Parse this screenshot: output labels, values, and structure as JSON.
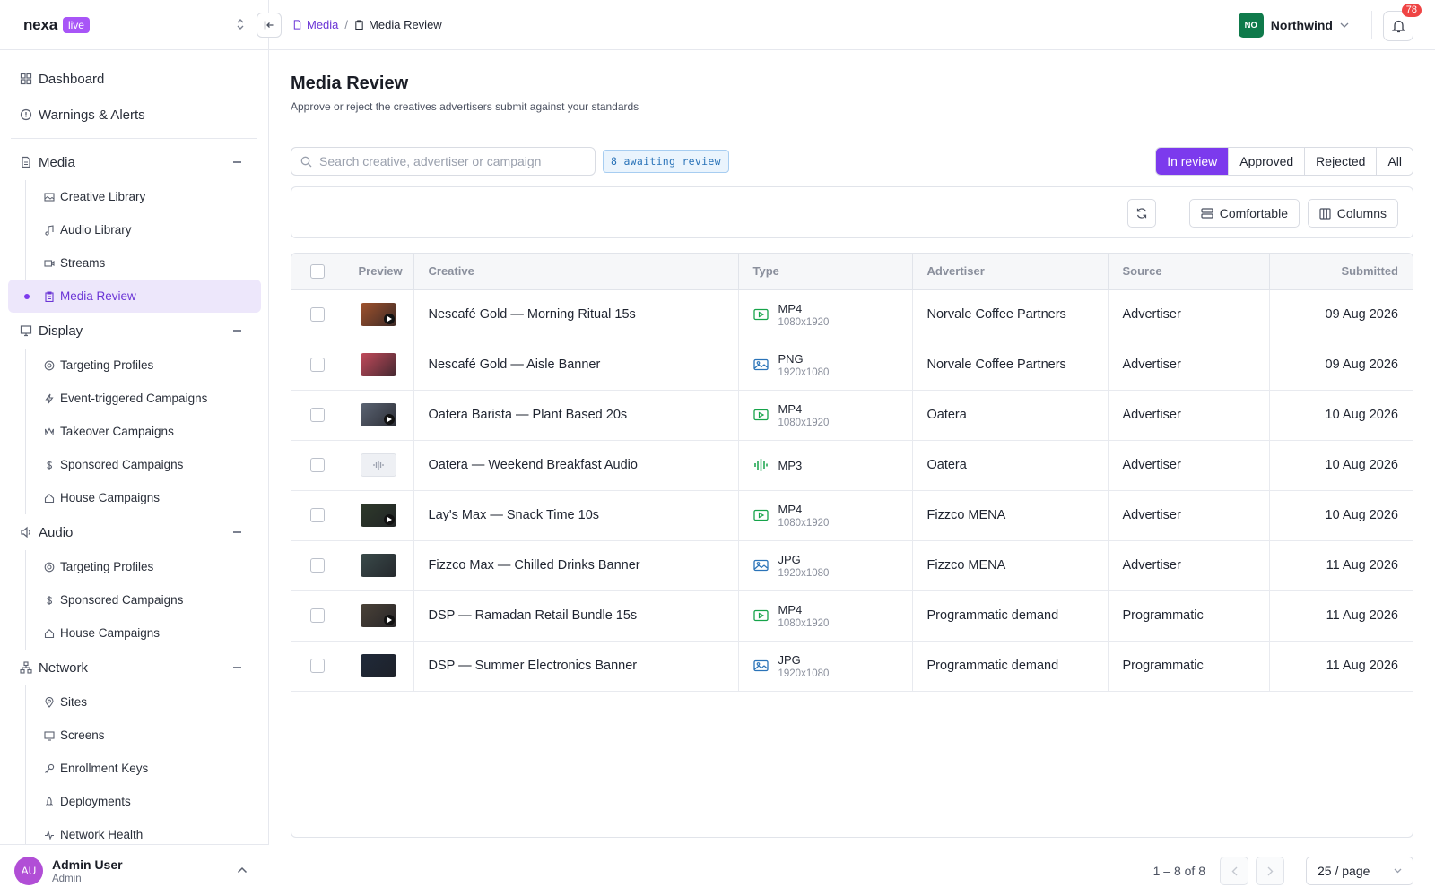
{
  "brand": {
    "name": "nexa",
    "badge": "live"
  },
  "sidebar": {
    "top": [
      {
        "label": "Dashboard",
        "icon": "grid-icon"
      },
      {
        "label": "Warnings & Alerts",
        "icon": "alert-circle-icon"
      }
    ],
    "groups": [
      {
        "label": "Media",
        "icon": "file-icon",
        "items": [
          {
            "label": "Creative Library",
            "icon": "images-icon"
          },
          {
            "label": "Audio Library",
            "icon": "music-note-icon"
          },
          {
            "label": "Streams",
            "icon": "video-icon"
          },
          {
            "label": "Media Review",
            "icon": "clipboard-icon",
            "active": true
          }
        ]
      },
      {
        "label": "Display",
        "icon": "monitor-icon",
        "items": [
          {
            "label": "Targeting Profiles",
            "icon": "target-icon"
          },
          {
            "label": "Event-triggered Campaigns",
            "icon": "bolt-icon"
          },
          {
            "label": "Takeover Campaigns",
            "icon": "crown-icon"
          },
          {
            "label": "Sponsored Campaigns",
            "icon": "dollar-icon"
          },
          {
            "label": "House Campaigns",
            "icon": "home-icon"
          }
        ]
      },
      {
        "label": "Audio",
        "icon": "speaker-icon",
        "items": [
          {
            "label": "Targeting Profiles",
            "icon": "target-icon"
          },
          {
            "label": "Sponsored Campaigns",
            "icon": "dollar-icon"
          },
          {
            "label": "House Campaigns",
            "icon": "home-icon"
          }
        ]
      },
      {
        "label": "Network",
        "icon": "network-icon",
        "items": [
          {
            "label": "Sites",
            "icon": "map-pin-icon"
          },
          {
            "label": "Screens",
            "icon": "screen-icon"
          },
          {
            "label": "Enrollment Keys",
            "icon": "key-icon"
          },
          {
            "label": "Deployments",
            "icon": "rocket-icon"
          },
          {
            "label": "Network Health",
            "icon": "activity-icon"
          }
        ]
      }
    ]
  },
  "user": {
    "initials": "AU",
    "name": "Admin User",
    "role": "Admin"
  },
  "header": {
    "breadcrumb": {
      "parent": "Media",
      "separator": "/",
      "current": "Media Review"
    },
    "org": {
      "initials": "NO",
      "name": "Northwind"
    },
    "notifications": "78"
  },
  "page": {
    "title": "Media Review",
    "subtitle": "Approve or reject the creatives advertisers submit against your standards"
  },
  "filters": {
    "search_placeholder": "Search creative, advertiser or campaign",
    "awaiting": "8 awaiting review",
    "tabs": [
      "In review",
      "Approved",
      "Rejected",
      "All"
    ],
    "active_tab": "In review"
  },
  "toolbar": {
    "density": "Comfortable",
    "columns": "Columns"
  },
  "table": {
    "headers": {
      "preview": "Preview",
      "creative": "Creative",
      "type": "Type",
      "advertiser": "Advertiser",
      "source": "Source",
      "submitted": "Submitted"
    },
    "rows": [
      {
        "creative": "Nescafé Gold — Morning Ritual 15s",
        "format": "MP4",
        "resolution": "1080x1920",
        "kind": "video",
        "thumb": "#a0522d",
        "advertiser": "Norvale Coffee Partners",
        "source": "Advertiser",
        "submitted": "09 Aug 2026"
      },
      {
        "creative": "Nescafé Gold — Aisle Banner",
        "format": "PNG",
        "resolution": "1920x1080",
        "kind": "image",
        "thumb": "#c24a5a",
        "advertiser": "Norvale Coffee Partners",
        "source": "Advertiser",
        "submitted": "09 Aug 2026"
      },
      {
        "creative": "Oatera Barista — Plant Based 20s",
        "format": "MP4",
        "resolution": "1080x1920",
        "kind": "video",
        "thumb": "#5b6473",
        "advertiser": "Oatera",
        "source": "Advertiser",
        "submitted": "10 Aug 2026"
      },
      {
        "creative": "Oatera — Weekend Breakfast Audio",
        "format": "MP3",
        "resolution": "",
        "kind": "audio",
        "thumb": "#eef0f4",
        "advertiser": "Oatera",
        "source": "Advertiser",
        "submitted": "10 Aug 2026"
      },
      {
        "creative": "Lay's Max — Snack Time 10s",
        "format": "MP4",
        "resolution": "1080x1920",
        "kind": "video",
        "thumb": "#2e3a2b",
        "advertiser": "Fizzco MENA",
        "source": "Advertiser",
        "submitted": "10 Aug 2026"
      },
      {
        "creative": "Fizzco Max — Chilled Drinks Banner",
        "format": "JPG",
        "resolution": "1920x1080",
        "kind": "image",
        "thumb": "#3a4a4a",
        "advertiser": "Fizzco MENA",
        "source": "Advertiser",
        "submitted": "11 Aug 2026"
      },
      {
        "creative": "DSP — Ramadan Retail Bundle 15s",
        "format": "MP4",
        "resolution": "1080x1920",
        "kind": "video",
        "thumb": "#4a4238",
        "advertiser": "Programmatic demand",
        "source": "Programmatic",
        "submitted": "11 Aug 2026"
      },
      {
        "creative": "DSP — Summer Electronics Banner",
        "format": "JPG",
        "resolution": "1920x1080",
        "kind": "image",
        "thumb": "#1f2a3a",
        "advertiser": "Programmatic demand",
        "source": "Programmatic",
        "submitted": "11 Aug 2026"
      }
    ]
  },
  "pagination": {
    "range": "1 – 8 of 8",
    "per_page": "25 / page"
  },
  "colors": {
    "accent": "#7c3aed",
    "org": "#0f7a4b",
    "badge": "#a855f7",
    "alert": "#ef4444"
  }
}
